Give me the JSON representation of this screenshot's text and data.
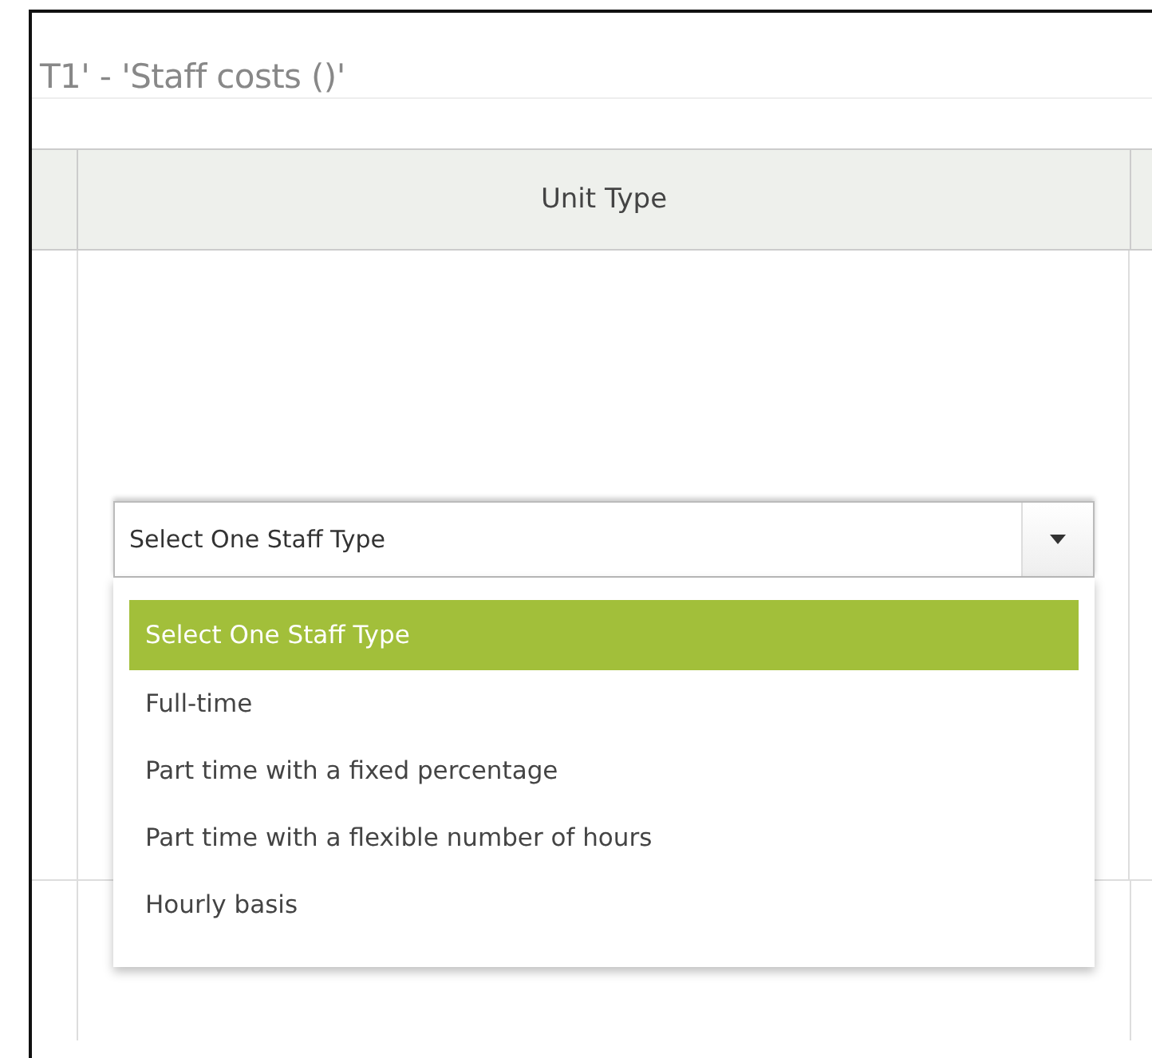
{
  "page": {
    "title": "T1' - 'Staff costs ()'"
  },
  "table": {
    "columns": [
      "Unit Type"
    ]
  },
  "select": {
    "value": "Select One Staff Type",
    "expanded": true,
    "options": [
      {
        "label": "Select One Staff Type",
        "selected": true
      },
      {
        "label": "Full-time",
        "selected": false
      },
      {
        "label": "Part time with a fixed percentage",
        "selected": false
      },
      {
        "label": "Part time with a flexible number of hours",
        "selected": false
      },
      {
        "label": "Hourly basis",
        "selected": false
      }
    ]
  }
}
